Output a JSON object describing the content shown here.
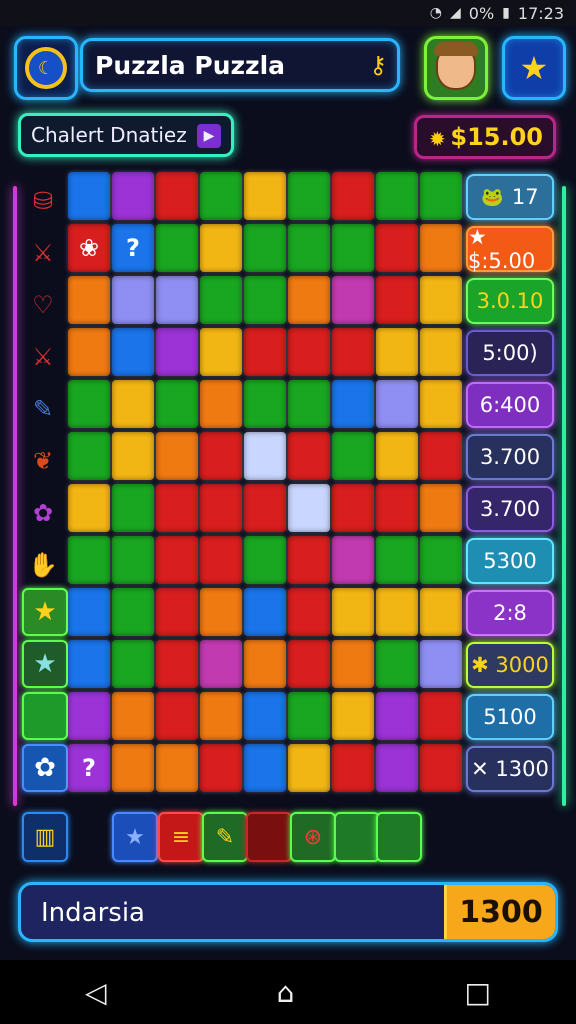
{
  "status_bar": {
    "battery": "0%",
    "time": "17:23",
    "icons": [
      "wifi-icon",
      "signal-icon",
      "battery-icon"
    ]
  },
  "header": {
    "title": "Puzzla Puzzla",
    "clock_icon": "clock-icon",
    "key_icon": "key-icon",
    "avatar_icon": "avatar-icon",
    "star_icon": "star-icon"
  },
  "subheader": {
    "level_label": "Chalert Dnatiez",
    "money": "$15.00"
  },
  "side_icons": [
    "bucket-icon",
    "sword-icon",
    "heart-icon",
    "sword-icon",
    "pencil-icon",
    "lizard-icon",
    "flower-icon",
    "hand-icon"
  ],
  "side_tiles": [
    {
      "icon": "star-icon",
      "glyph": "★",
      "color": "#2a8a26",
      "glyph_color": "#ffd21c"
    },
    {
      "icon": "star-icon",
      "glyph": "★",
      "color": "#1f5c2a",
      "glyph_color": "#8ae0e0"
    },
    {
      "icon": "blank-tile",
      "glyph": "",
      "color": "#1d9a2a",
      "glyph_color": "#fff"
    },
    {
      "icon": "badge-icon",
      "glyph": "✿",
      "color": "#1656b0",
      "glyph_color": "#fff"
    }
  ],
  "board": {
    "colors": {
      "B": "#1b74ea",
      "P": "#9b33d6",
      "R": "#d81e1e",
      "G": "#19a621",
      "Y": "#f2b614",
      "O": "#f07a12",
      "L": "#8f8ef2",
      "D": "#0f2f9a",
      "K": "#25d34a",
      "M": "#c23ab0",
      "W": "#c9d6ff",
      "S": "#a8184a"
    },
    "rows": [
      "BPRGYGRGG",
      "RBGYGGGRO",
      "OLLGGOMRY",
      "OBPYRRRYY",
      "GYGOGGBLY",
      "GYORWRGYR",
      "YGRRRWRRO",
      "GGRRGRMGG",
      "BGROBRYYY",
      "BGRMOROGL",
      "POROBGYPR",
      "POORBYRPR"
    ],
    "glyphs": [
      {
        "row": 1,
        "col": 0,
        "glyph": "❀",
        "icon": "flower-icon"
      },
      {
        "row": 1,
        "col": 1,
        "glyph": "?",
        "icon": "question-icon"
      },
      {
        "row": 11,
        "col": 0,
        "glyph": "?",
        "icon": "question-icon"
      }
    ]
  },
  "score_items": [
    {
      "text": "17",
      "bg": "#2c6f9a",
      "border": "#5fd0ff",
      "color": "#fff",
      "icon": "frog-icon"
    },
    {
      "text": "★ $:5.00",
      "bg": "#f25a16",
      "border": "#ff9a3a",
      "color": "#fff",
      "icon": ""
    },
    {
      "text": "3.0.10",
      "bg": "#1aa52a",
      "border": "#6cff5a",
      "color": "#ffd21c",
      "icon": ""
    },
    {
      "text": "5:00)",
      "bg": "#2a2456",
      "border": "#6a5ad0",
      "color": "#fff",
      "icon": ""
    },
    {
      "text": "6:400",
      "bg": "#7f2fbf",
      "border": "#c26aff",
      "color": "#fff",
      "icon": ""
    },
    {
      "text": "3.700",
      "bg": "#28305e",
      "border": "#6a7ad0",
      "color": "#fff",
      "icon": ""
    },
    {
      "text": "3.700",
      "bg": "#35256a",
      "border": "#8a5ae0",
      "color": "#fff",
      "icon": ""
    },
    {
      "text": "5300",
      "bg": "#1e8fb2",
      "border": "#5fe8ff",
      "color": "#fff",
      "icon": ""
    },
    {
      "text": "2:8",
      "bg": "#8a33c6",
      "border": "#d070ff",
      "color": "#fff",
      "icon": ""
    },
    {
      "text": "✱ 3000",
      "bg": "#2f3a62",
      "border": "#b6ff3a",
      "color": "#ffd21c",
      "icon": ""
    },
    {
      "text": "5100",
      "bg": "#1e6fa8",
      "border": "#5fd0ff",
      "color": "#fff",
      "icon": ""
    },
    {
      "text": "✕ 1300",
      "bg": "#28305e",
      "border": "#6a7ad0",
      "color": "#fff",
      "icon": ""
    }
  ],
  "tray": [
    {
      "glyph": "▥",
      "icon": "chest-icon",
      "bg": "#0f2f6a",
      "border": "#2a8af0",
      "color": "#ffd21c"
    },
    {
      "glyph": "★",
      "icon": "star-icon",
      "bg": "#1b4eb8",
      "border": "#4a8aff",
      "color": "#8ab0ff"
    },
    {
      "glyph": "≡",
      "icon": "cake-icon",
      "bg": "#c41818",
      "border": "#ff4a4a",
      "color": "#ffd21c"
    },
    {
      "glyph": "✎",
      "icon": "marker-icon",
      "bg": "#1f6a24",
      "border": "#5aff4a",
      "color": "#ffd21c"
    },
    {
      "glyph": "",
      "icon": "blank-tile",
      "bg": "#7a0f0f",
      "border": "#c42a2a",
      "color": "#fff"
    },
    {
      "glyph": "⊛",
      "icon": "bug-icon",
      "bg": "#1f6a24",
      "border": "#5aff4a",
      "color": "#ff3a3a"
    },
    {
      "glyph": "",
      "icon": "blank-tile",
      "bg": "#1f7a28",
      "border": "#5aff4a",
      "color": "#fff"
    },
    {
      "glyph": "",
      "icon": "blank-tile",
      "bg": "#1f7a28",
      "border": "#5aff4a",
      "color": "#fff"
    }
  ],
  "bottom": {
    "label": "Indarsia",
    "value": "1300"
  },
  "nav": {
    "back": "◁",
    "home": "⌂",
    "recent": "□"
  }
}
